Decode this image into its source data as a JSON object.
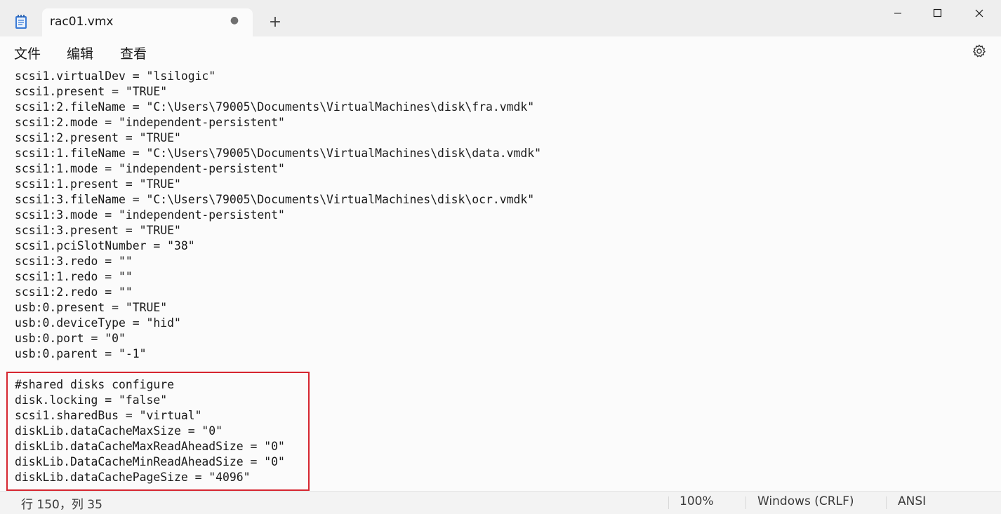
{
  "tab": {
    "title": "rac01.vmx"
  },
  "menu": {
    "file": "文件",
    "edit": "编辑",
    "view": "查看"
  },
  "editor": {
    "lines": [
      "scsi1.virtualDev = \"lsilogic\"",
      "scsi1.present = \"TRUE\"",
      "scsi1:2.fileName = \"C:\\Users\\79005\\Documents\\VirtualMachines\\disk\\fra.vmdk\"",
      "scsi1:2.mode = \"independent-persistent\"",
      "scsi1:2.present = \"TRUE\"",
      "scsi1:1.fileName = \"C:\\Users\\79005\\Documents\\VirtualMachines\\disk\\data.vmdk\"",
      "scsi1:1.mode = \"independent-persistent\"",
      "scsi1:1.present = \"TRUE\"",
      "scsi1:3.fileName = \"C:\\Users\\79005\\Documents\\VirtualMachines\\disk\\ocr.vmdk\"",
      "scsi1:3.mode = \"independent-persistent\"",
      "scsi1:3.present = \"TRUE\"",
      "scsi1.pciSlotNumber = \"38\"",
      "scsi1:3.redo = \"\"",
      "scsi1:1.redo = \"\"",
      "scsi1:2.redo = \"\"",
      "usb:0.present = \"TRUE\"",
      "usb:0.deviceType = \"hid\"",
      "usb:0.port = \"0\"",
      "usb:0.parent = \"-1\"",
      "",
      "#shared disks configure",
      "disk.locking = \"false\"",
      "scsi1.sharedBus = \"virtual\"",
      "diskLib.dataCacheMaxSize = \"0\"",
      "diskLib.dataCacheMaxReadAheadSize = \"0\"",
      "diskLib.DataCacheMinReadAheadSize = \"0\"",
      "diskLib.dataCachePageSize = \"4096\""
    ]
  },
  "status": {
    "position": "行 150，列 35",
    "zoom": "100%",
    "line_ending": "Windows (CRLF)",
    "encoding": "ANSI"
  },
  "icons": {
    "app": "notepad-icon",
    "tab_close": "close-dot-icon",
    "new_tab": "plus-icon",
    "minimize": "minimize-icon",
    "maximize": "maximize-icon",
    "close": "close-icon",
    "settings": "gear-icon"
  },
  "colors": {
    "highlight_border": "#d62630",
    "editor_bg": "#fbfbfb",
    "chrome_bg": "#eeeeee"
  }
}
